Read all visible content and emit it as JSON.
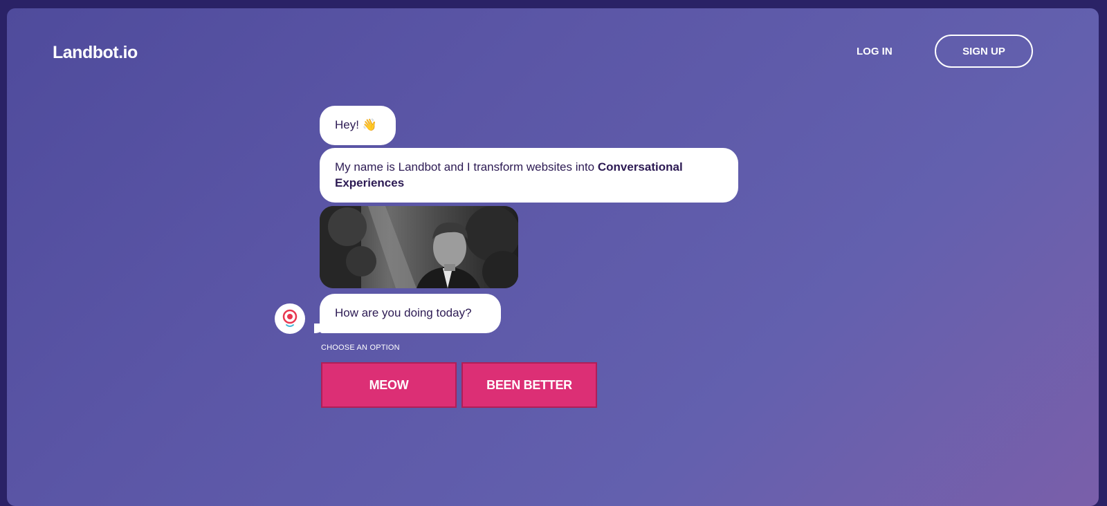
{
  "header": {
    "logo": "Landbot.io",
    "login_label": "LOG IN",
    "signup_label": "SIGN UP"
  },
  "chat": {
    "messages": [
      {
        "text": "Hey! 👋"
      },
      {
        "text_plain": "My name is Landbot and I transform websites into ",
        "text_bold": "Conversational Experiences"
      },
      {
        "type": "gif"
      },
      {
        "text": "How are you doing today?"
      }
    ],
    "choose_label": "CHOOSE AN OPTION",
    "options": [
      {
        "label": "MEOW"
      },
      {
        "label": "BEEN BETTER"
      }
    ]
  },
  "colors": {
    "background_start": "#4f4b9c",
    "background_end": "#7a5faa",
    "option_button": "#dc2f75",
    "bubble_text": "#2c1a53",
    "bot_avatar_accent": "#e8374f"
  },
  "icons": {
    "avatar": "landbot-avatar-icon"
  }
}
